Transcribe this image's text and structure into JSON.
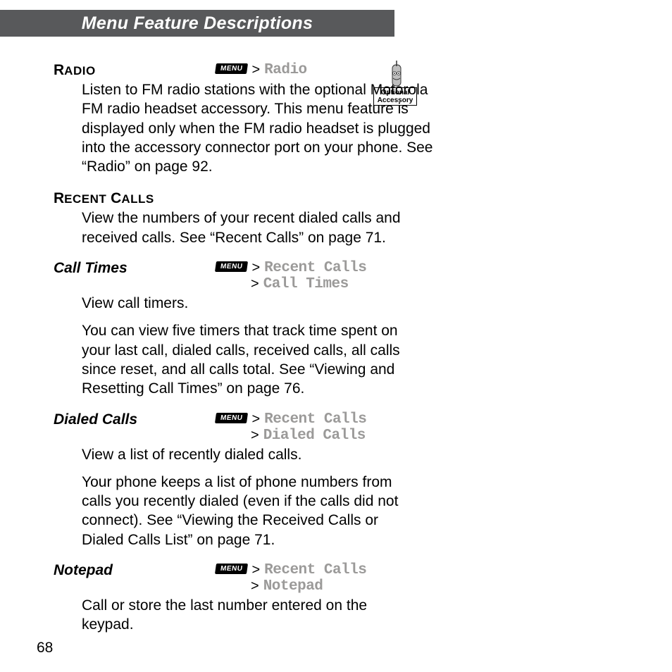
{
  "header": {
    "title": "Menu Feature Descriptions"
  },
  "menu_button_label": "MENU",
  "accessory_badge": {
    "line1": "Optional",
    "line2": "Accessory"
  },
  "sections": {
    "radio": {
      "title_first": "R",
      "title_rest": "ADIO",
      "nav": {
        "path1": "Radio"
      },
      "body": "Listen to FM radio stations with the optional Motorola FM radio headset accessory. This menu feature is displayed only when the FM radio headset is plugged into the accessory connector port on your phone. See “Radio” on page 92."
    },
    "recent_calls": {
      "title_first": "R",
      "title_rest_a": "ECENT",
      "title_first_b": "C",
      "title_rest_b": "ALLS",
      "body": "View the numbers of your recent dialed calls and received calls. See “Recent Calls” on page 71."
    },
    "call_times": {
      "title": "Call Times",
      "nav": {
        "path1": "Recent Calls",
        "path2": "Call Times"
      },
      "body1": "View call timers.",
      "body2": "You can view five timers that track time spent on your last call, dialed calls, received calls, all calls since reset, and all calls total. See “Viewing and Resetting Call Times” on page 76."
    },
    "dialed_calls": {
      "title": "Dialed Calls",
      "nav": {
        "path1": "Recent Calls",
        "path2": "Dialed Calls"
      },
      "body1": "View a list of recently dialed calls.",
      "body2": "Your phone keeps a list of phone numbers from calls you recently dialed (even if the calls did not connect). See “Viewing the Received Calls or Dialed Calls List” on page 71."
    },
    "notepad": {
      "title": "Notepad",
      "nav": {
        "path1": "Recent Calls",
        "path2": "Notepad"
      },
      "body": "Call or store the last number entered on the keypad."
    }
  },
  "page_number": "68"
}
